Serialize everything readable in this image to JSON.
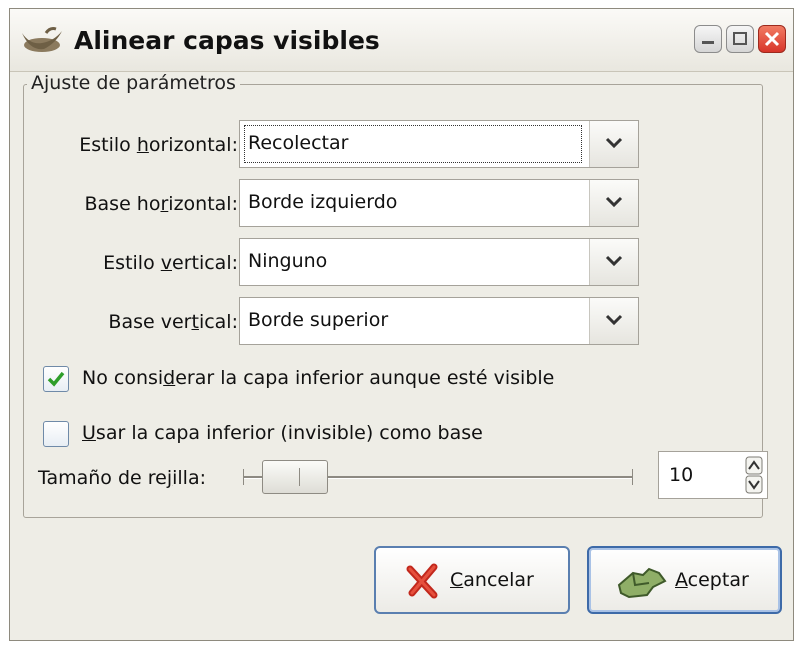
{
  "window": {
    "title": "Alinear capas visibles"
  },
  "frame": {
    "legend": "Ajuste de parámetros"
  },
  "fields": [
    {
      "label_pre": "Estilo ",
      "label_key": "h",
      "label_post": "orizontal:",
      "value": "Recolectar"
    },
    {
      "label_pre": "Base ho",
      "label_key": "r",
      "label_post": "izontal:",
      "value": "Borde izquierdo"
    },
    {
      "label_pre": "Estilo ",
      "label_key": "v",
      "label_post": "ertical:",
      "value": "Ninguno"
    },
    {
      "label_pre": "Base ver",
      "label_key": "t",
      "label_post": "ical:",
      "value": "Borde superior"
    }
  ],
  "checkboxes": [
    {
      "pre": "No consi",
      "key": "d",
      "post": "erar la capa inferior aunque esté visible",
      "checked": true
    },
    {
      "pre": "",
      "key": "U",
      "post": "sar la capa inferior (invisible) como base",
      "checked": false
    }
  ],
  "grid": {
    "label_pre": "Tamaño de re",
    "label_key": "j",
    "label_post": "illa:",
    "value": "10"
  },
  "buttons": {
    "cancel": {
      "key": "C",
      "rest": "ancelar"
    },
    "ok": {
      "key": "A",
      "rest": "ceptar"
    }
  }
}
